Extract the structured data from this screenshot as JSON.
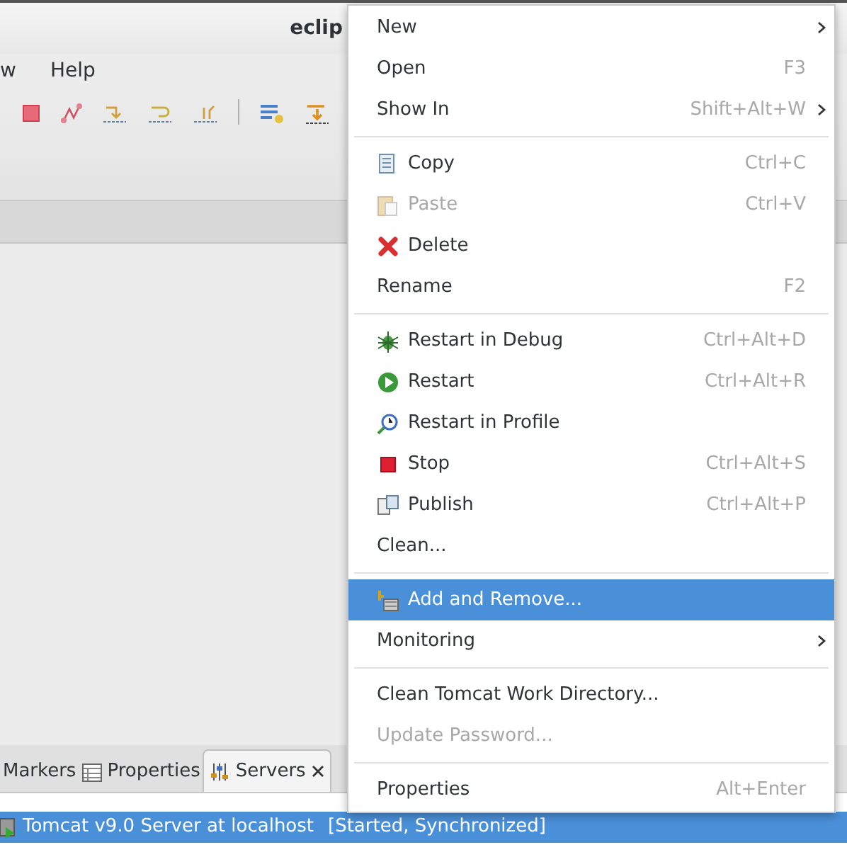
{
  "window": {
    "title": "eclip"
  },
  "menubar": [
    "w",
    "Help"
  ],
  "view_tabs": [
    {
      "label": "Markers",
      "selected": false
    },
    {
      "label": "Properties",
      "selected": false
    },
    {
      "label": "Servers",
      "selected": true
    }
  ],
  "servers": [
    {
      "name": "Tomcat v9.0 Server at localhost",
      "status": "[Started, Synchronized]",
      "selected": true
    }
  ],
  "context_menu": {
    "groups": [
      [
        {
          "kind": "plain",
          "label": "New",
          "submenu": true,
          "disabled": false,
          "selected": false
        },
        {
          "kind": "plain",
          "label": "Open",
          "shortcut": "F3",
          "submenu": false,
          "disabled": false,
          "selected": false
        },
        {
          "kind": "plain",
          "label": "Show In",
          "shortcut": "Shift+Alt+W",
          "submenu": true,
          "disabled": false,
          "selected": false
        }
      ],
      [
        {
          "kind": "icon",
          "label": "Copy",
          "shortcut": "Ctrl+C",
          "submenu": false,
          "disabled": false,
          "selected": false
        },
        {
          "kind": "icon",
          "label": "Paste",
          "shortcut": "Ctrl+V",
          "submenu": false,
          "disabled": true,
          "selected": false
        },
        {
          "kind": "icon",
          "label": "Delete",
          "submenu": false,
          "disabled": false,
          "selected": false
        },
        {
          "kind": "plain",
          "label": "Rename",
          "shortcut": "F2",
          "submenu": false,
          "disabled": false,
          "selected": false
        }
      ],
      [
        {
          "kind": "icon",
          "label": "Restart in Debug",
          "shortcut": "Ctrl+Alt+D",
          "submenu": false,
          "disabled": false,
          "selected": false
        },
        {
          "kind": "icon",
          "label": "Restart",
          "shortcut": "Ctrl+Alt+R",
          "submenu": false,
          "disabled": false,
          "selected": false
        },
        {
          "kind": "icon",
          "label": "Restart in Profile",
          "submenu": false,
          "disabled": false,
          "selected": false
        },
        {
          "kind": "icon",
          "label": "Stop",
          "shortcut": "Ctrl+Alt+S",
          "submenu": false,
          "disabled": false,
          "selected": false
        },
        {
          "kind": "icon",
          "label": "Publish",
          "shortcut": "Ctrl+Alt+P",
          "submenu": false,
          "disabled": false,
          "selected": false
        },
        {
          "kind": "plain",
          "label": "Clean...",
          "submenu": false,
          "disabled": false,
          "selected": false
        }
      ],
      [
        {
          "kind": "icon",
          "label": "Add and Remove...",
          "submenu": false,
          "disabled": false,
          "selected": true
        },
        {
          "kind": "plain",
          "label": "Monitoring",
          "submenu": true,
          "disabled": false,
          "selected": false
        }
      ],
      [
        {
          "kind": "plain",
          "label": "Clean Tomcat Work Directory...",
          "submenu": false,
          "disabled": false,
          "selected": false
        },
        {
          "kind": "plain",
          "label": "Update Password...",
          "submenu": false,
          "disabled": true,
          "selected": false
        }
      ],
      [
        {
          "kind": "plain",
          "label": "Properties",
          "shortcut": "Alt+Enter",
          "submenu": false,
          "disabled": false,
          "selected": false
        }
      ]
    ]
  }
}
